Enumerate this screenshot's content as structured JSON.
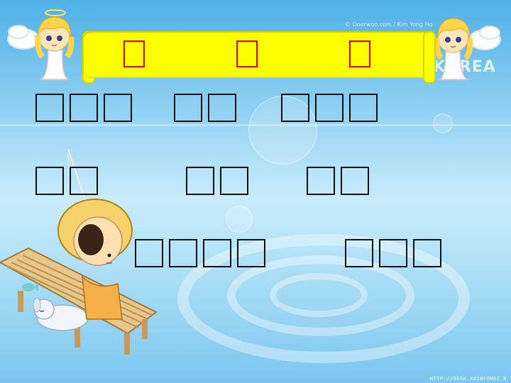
{
  "watermark": {
    "credit": "© Ooorwoo.com / Kim Yong Ho",
    "brand": "KOREA"
  },
  "title": {
    "glyph_count": 3,
    "note": "three characters rendered as empty placeholder boxes"
  },
  "rows": [
    {
      "groups": [
        3,
        2,
        3
      ]
    },
    {
      "groups": [
        2,
        2,
        2
      ]
    },
    {
      "groups": [
        4,
        3
      ]
    }
  ],
  "footer": {
    "url": "HTTP://DESK.XXINFOMAC.N"
  },
  "colors": {
    "banner": "#ffff00",
    "title_glyph_border": "#e0001a",
    "glyph_border": "#111111",
    "water": "#8fd0f2"
  },
  "icons": [
    "angel-left-icon",
    "angel-right-icon",
    "fishing-boy-icon",
    "dock-icon",
    "sleeping-dog-icon"
  ]
}
